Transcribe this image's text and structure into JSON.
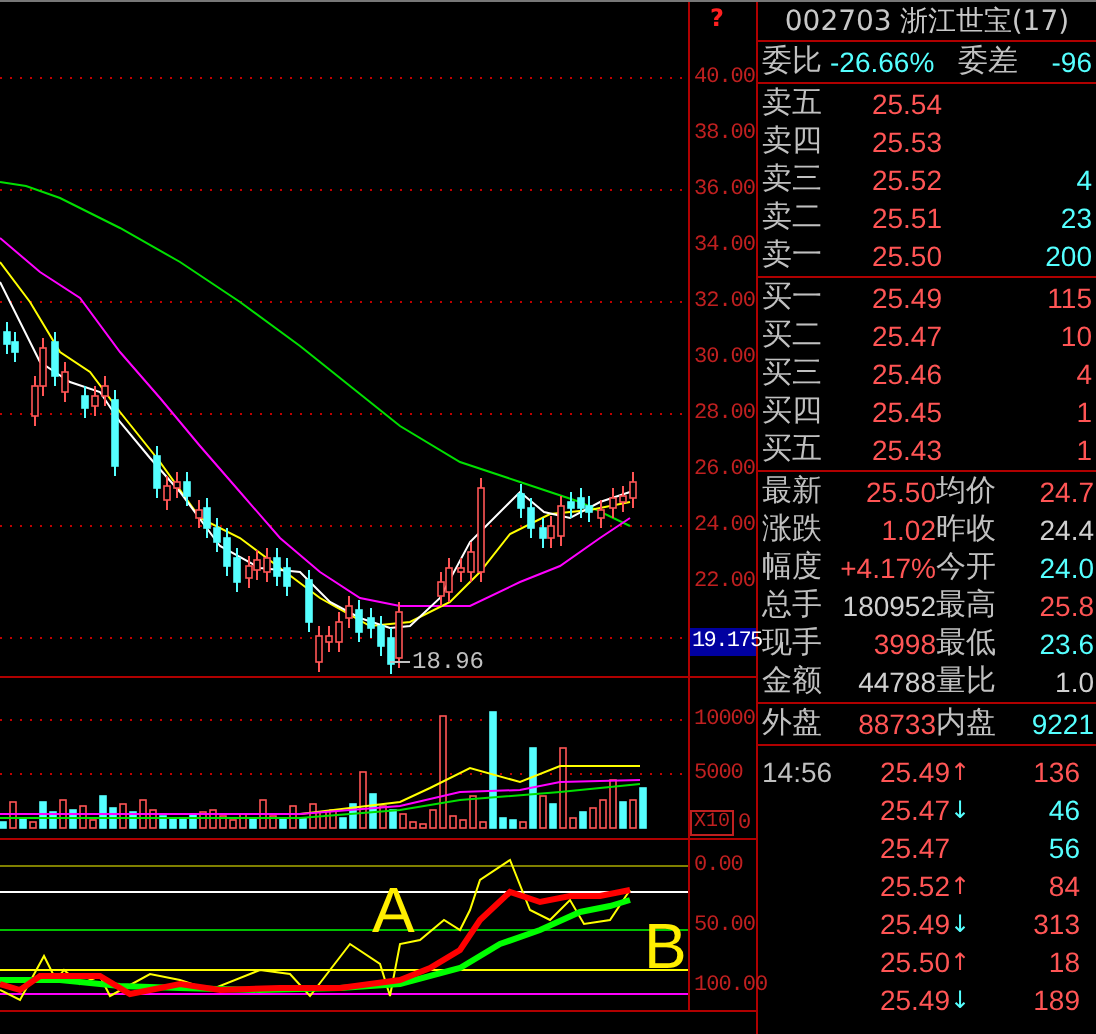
{
  "price_axis": {
    "marker": "?",
    "labels": [
      "40.00",
      "38.00",
      "36.00",
      "34.00",
      "32.00",
      "30.00",
      "28.00",
      "26.00",
      "24.00",
      "22.00"
    ],
    "current": "19.175"
  },
  "low_label": "18.96",
  "volume_axis": {
    "labels": [
      "10000",
      "5000"
    ],
    "unit": "X10",
    "zero": "0"
  },
  "indicator_axis": [
    "0.00",
    "50.00",
    "100.00"
  ],
  "annotations": [
    "A",
    "B"
  ],
  "stock_header": {
    "code": "002703",
    "name": "浙江世宝(17)"
  },
  "order_ratio": {
    "label": "委比",
    "value": "-26.66%",
    "diff_label": "委差",
    "diff_value": "-96"
  },
  "asks": [
    {
      "label": "卖五",
      "price": "25.54"
    },
    {
      "label": "卖四",
      "price": "25.53"
    },
    {
      "label": "卖三",
      "price": "25.52",
      "volume": "4"
    },
    {
      "label": "卖二",
      "price": "25.51",
      "volume": "23"
    },
    {
      "label": "卖一",
      "price": "25.50",
      "volume": "200"
    }
  ],
  "bids": [
    {
      "label": "买一",
      "price": "25.49",
      "volume": "115"
    },
    {
      "label": "买二",
      "price": "25.47",
      "volume": "10"
    },
    {
      "label": "买三",
      "price": "25.46",
      "volume": "4"
    },
    {
      "label": "买四",
      "price": "25.45",
      "volume": "1"
    },
    {
      "label": "买五",
      "price": "25.43",
      "volume": "1"
    }
  ],
  "stats": [
    {
      "cells": [
        {
          "label": "最新",
          "value": "25.50",
          "color": "#ff5555"
        },
        {
          "label": "均价",
          "value": "24.7",
          "color": "#ff5555"
        }
      ]
    },
    {
      "cells": [
        {
          "label": "涨跌",
          "value": "1.02",
          "color": "#ff5555"
        },
        {
          "label": "昨收",
          "value": "24.4",
          "color": "#d0d0d0"
        }
      ]
    },
    {
      "cells": [
        {
          "label": "幅度",
          "value": "+4.17%",
          "color": "#ff5555"
        },
        {
          "label": "今开",
          "value": "24.0",
          "color": "#55ffff"
        }
      ]
    },
    {
      "cells": [
        {
          "label": "总手",
          "value": "180952",
          "color": "#d0d0d0"
        },
        {
          "label": "最高",
          "value": "25.8",
          "color": "#ff5555"
        }
      ]
    },
    {
      "cells": [
        {
          "label": "现手",
          "value": "3998",
          "color": "#ff5555"
        },
        {
          "label": "最低",
          "value": "23.6",
          "color": "#55ffff"
        }
      ]
    },
    {
      "cells": [
        {
          "label": "金额",
          "value": "44788",
          "color": "#d0d0d0"
        },
        {
          "label": "量比",
          "value": "1.0",
          "color": "#d0d0d0"
        }
      ]
    }
  ],
  "outer_inner": {
    "label": "外盘",
    "value": "88733",
    "label2": "内盘",
    "value2": "9221"
  },
  "ticks": [
    {
      "time": "14:56",
      "price": "25.49",
      "arrow": {
        "glyph": "↑",
        "color": "#ff5555"
      },
      "volume": "136",
      "color": "#ff5555"
    },
    {
      "price": "25.47",
      "arrow": {
        "glyph": "↓",
        "color": "#55ffff"
      },
      "volume": "46",
      "color": "#55ffff"
    },
    {
      "price": "25.47",
      "volume": "56",
      "color": "#55ffff"
    },
    {
      "price": "25.52",
      "arrow": {
        "glyph": "↑",
        "color": "#ff5555"
      },
      "volume": "84",
      "color": "#ff5555"
    },
    {
      "price": "25.49",
      "arrow": {
        "glyph": "↓",
        "color": "#55ffff"
      },
      "volume": "313",
      "color": "#ff5555"
    },
    {
      "price": "25.50",
      "arrow": {
        "glyph": "↑",
        "color": "#ff5555"
      },
      "volume": "18",
      "color": "#ff5555"
    },
    {
      "price": "25.49",
      "arrow": {
        "glyph": "↓",
        "color": "#55ffff"
      },
      "volume": "189",
      "color": "#ff5555"
    }
  ]
}
